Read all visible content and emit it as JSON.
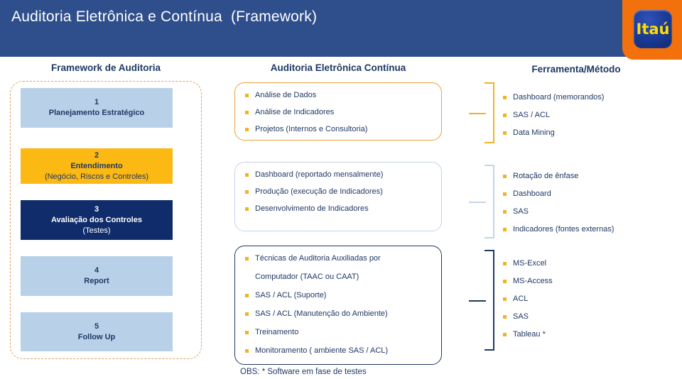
{
  "header": {
    "title": "Auditoria Eletrônica e Contínua  (Framework)",
    "logo_text": "Itaú",
    "band_color": "#2e4f8c",
    "logo_bg_color": "#f2710c",
    "logo_tile_color": "#1c3c9b",
    "logo_text_color": "#ffdd00"
  },
  "columns": {
    "left_heading": "Framework de Auditoria",
    "middle_heading": "Auditoria Eletrônica Contínua",
    "right_heading": "Ferramenta/Método"
  },
  "framework_stages": [
    {
      "number": "1",
      "label": "Planejamento Estratégico",
      "sub": "",
      "bg": "#b8d1e8",
      "fg": "#1f3864"
    },
    {
      "number": "2",
      "label": "Entendimento",
      "sub": "(Negócio, Riscos e Controles)",
      "bg": "#fcb913",
      "fg": "#1f3864"
    },
    {
      "number": "3",
      "label": "Avaliação dos Controles",
      "sub": "(Testes)",
      "bg": "#102c6b",
      "fg": "#ffffff"
    },
    {
      "number": "4",
      "label": "Report",
      "sub": "",
      "bg": "#b8d1e8",
      "fg": "#1f3864"
    },
    {
      "number": "5",
      "label": "Follow Up",
      "sub": "",
      "bg": "#b8d1e8",
      "fg": "#1f3864"
    }
  ],
  "panels": [
    {
      "border_color": "#e8a33d",
      "items": [
        {
          "text": "Análise de Dados",
          "bullet": true
        },
        {
          "text": "Análise de Indicadores",
          "bullet": true
        },
        {
          "text": "Projetos (Internos e Consultoria)",
          "bullet": true
        }
      ]
    },
    {
      "border_color": "#c3d4e8",
      "items": [
        {
          "text": "Dashboard (reportado mensalmente)",
          "bullet": true
        },
        {
          "text": "Produção (execução de Indicadores)",
          "bullet": true
        },
        {
          "text": "Desenvolvimento de Indicadores",
          "bullet": true
        }
      ]
    },
    {
      "border_color": "#1f3864",
      "items": [
        {
          "text": "Técnicas de Auditoria Auxiliadas por",
          "bullet": true
        },
        {
          "text": "Computador (TAAC ou CAAT)",
          "bullet": false
        },
        {
          "text": "SAS / ACL (Suporte)",
          "bullet": true
        },
        {
          "text": "SAS / ACL (Manutenção do Ambiente)",
          "bullet": true
        },
        {
          "text": "Treinamento",
          "bullet": true
        },
        {
          "text": "Monitoramento ( ambiente SAS / ACL)",
          "bullet": true
        }
      ]
    }
  ],
  "tool_groups": [
    {
      "bracket_color": "#f0b323",
      "items": [
        {
          "text": "Dashboard (memorandos)"
        },
        {
          "text": "SAS / ACL"
        },
        {
          "text": "Data Mining"
        }
      ]
    },
    {
      "bracket_color": "#c3d4e8",
      "items": [
        {
          "text": "Rotação de ênfase"
        },
        {
          "text": "Dashboard"
        },
        {
          "text": "SAS"
        },
        {
          "text": "Indicadores (fontes externas)"
        }
      ]
    },
    {
      "bracket_color": "#1f3864",
      "items": [
        {
          "text": "MS-Excel"
        },
        {
          "text": "MS-Access"
        },
        {
          "text": "ACL"
        },
        {
          "text": "SAS"
        },
        {
          "text": "Tableau *"
        }
      ]
    }
  ],
  "footer": {
    "note": "OBS: * Software em fase de testes"
  },
  "accent_colors": {
    "bullet": "#f0b323",
    "navy": "#1f3864",
    "light_blue": "#b8d1e8",
    "amber": "#fcb913",
    "dashed_border": "#e0a060"
  }
}
